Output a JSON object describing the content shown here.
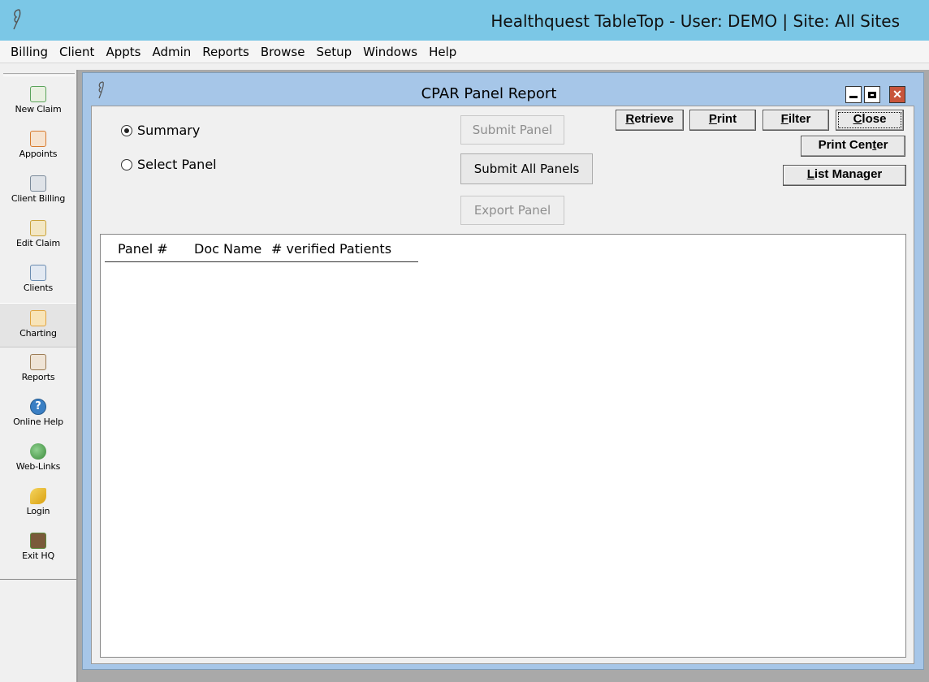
{
  "app": {
    "title": "Healthquest TableTop - User: DEMO | Site: All Sites"
  },
  "menu": [
    "Billing",
    "Client",
    "Appts",
    "Admin",
    "Reports",
    "Browse",
    "Setup",
    "Windows",
    "Help"
  ],
  "toolbar": {
    "items": [
      {
        "label": "New Claim",
        "icon": "new-claim-icon",
        "color": "#5aa35a"
      },
      {
        "label": "Appoints",
        "icon": "calendar-icon",
        "color": "#d77b2f"
      },
      {
        "label": "Client Billing",
        "icon": "cart-icon",
        "color": "#7b8a9a"
      },
      {
        "label": "Edit Claim",
        "icon": "edit-claim-icon",
        "color": "#c9a23a"
      },
      {
        "label": "Clients",
        "icon": "client-card-icon",
        "color": "#6a8cb0"
      },
      {
        "label": "Charting",
        "icon": "chart-folder-icon",
        "color": "#e0a440"
      },
      {
        "label": "Reports",
        "icon": "report-icon",
        "color": "#9a7a52"
      },
      {
        "label": "Online Help",
        "icon": "help-icon",
        "color": "#3a7fc4"
      },
      {
        "label": "Web-Links",
        "icon": "globe-icon",
        "color": "#4a9a4a"
      },
      {
        "label": "Login",
        "icon": "key-icon",
        "color": "#e0b020"
      },
      {
        "label": "Exit HQ",
        "icon": "exit-door-icon",
        "color": "#5c8a3c"
      }
    ],
    "selected": "Charting"
  },
  "window": {
    "title": "CPAR Panel Report",
    "minimize": "minimize",
    "maximize": "maximize",
    "close": "✕"
  },
  "options": {
    "summary": "Summary",
    "select_panel": "Select Panel",
    "selected": "summary"
  },
  "panel_buttons": {
    "submit_panel": "Submit Panel",
    "submit_all": "Submit All Panels",
    "export_panel": "Export Panel"
  },
  "actions": {
    "retrieve": {
      "first": "R",
      "rest": "etrieve"
    },
    "print": {
      "first": "P",
      "rest": "rint"
    },
    "filter": {
      "first": "F",
      "rest": "ilter"
    },
    "close": {
      "first": "C",
      "rest": "lose"
    },
    "print_center": {
      "pre": "Print Cen",
      "u": "t",
      "post": "er"
    },
    "list_manager": {
      "first": "L",
      "rest": "ist Manager"
    }
  },
  "list": {
    "columns": [
      "Panel #",
      "Doc Name",
      "# verified Patients"
    ],
    "rows": []
  }
}
